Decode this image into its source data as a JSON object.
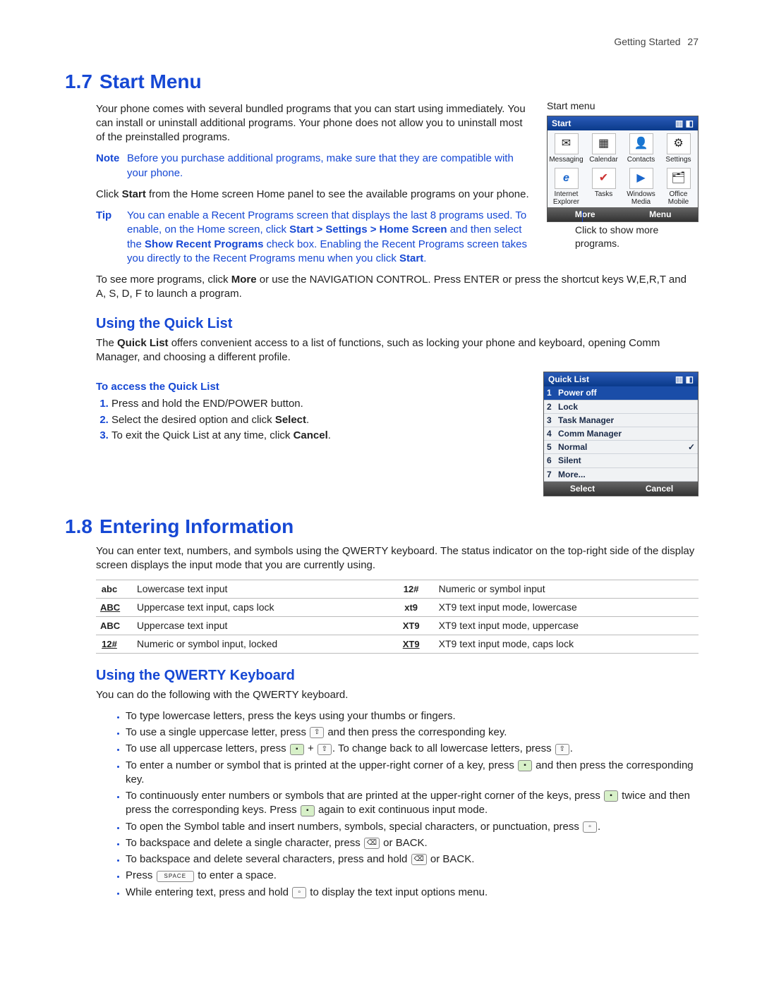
{
  "header": {
    "section": "Getting Started",
    "page": "27"
  },
  "sec17": {
    "num": "1.7",
    "title": "Start Menu",
    "intro": "Your phone comes with several bundled programs that you can start using immediately. You can install or uninstall additional programs. Your phone does not allow you to uninstall most of the preinstalled programs.",
    "note_label": "Note",
    "note": "Before you purchase additional programs, make sure that they are compatible with your phone.",
    "click_start_pre": "Click ",
    "click_start_bold": "Start",
    "click_start_post": " from the Home screen Home panel to see the available programs on your phone.",
    "tip_label": "Tip",
    "tip_pre": "You can enable a Recent Programs screen that displays the last 8 programs used. To enable, on the Home screen, click ",
    "tip_b1": "Start > Settings > Home Screen",
    "tip_mid": " and then select the ",
    "tip_b2": "Show Recent Programs",
    "tip_post": " check box. Enabling the Recent Programs screen takes you directly to the Recent Programs menu when you click ",
    "tip_b3": "Start",
    "more_pre": "To see more programs, click ",
    "more_bold": "More",
    "more_post": " or use the NAVIGATION CONTROL. Press ENTER or press the shortcut keys W,E,R,T and A, S, D, F to launch a program.",
    "fig_caption": "Start menu",
    "fig": {
      "title": "Start",
      "icons": [
        {
          "glyph": "✉",
          "label": "Messaging"
        },
        {
          "glyph": "▦",
          "label": "Calendar"
        },
        {
          "glyph": "👤",
          "label": "Contacts"
        },
        {
          "glyph": "⚙",
          "label": "Settings"
        },
        {
          "glyph": "e",
          "label": "Internet Explorer"
        },
        {
          "glyph": "✔",
          "label": "Tasks"
        },
        {
          "glyph": "▶",
          "label": "Windows Media"
        },
        {
          "glyph": "🗂",
          "label": "Office Mobile"
        }
      ],
      "soft_left": "More",
      "soft_right": "Menu"
    },
    "arrow_caption": "Click to show more programs."
  },
  "quicklist": {
    "heading": "Using the Quick List",
    "intro_pre": "The ",
    "intro_bold": "Quick List",
    "intro_post": " offers convenient access to a list of functions, such as locking your phone and keyboard, opening Comm Manager, and choosing a different profile.",
    "sub": "To access the Quick List",
    "steps": [
      {
        "pre": "Press and hold the END/POWER button."
      },
      {
        "pre": "Select the desired option and click ",
        "bold": "Select",
        "post": "."
      },
      {
        "pre": "To exit the Quick List at any time, click ",
        "bold": "Cancel",
        "post": "."
      }
    ],
    "fig": {
      "title": "Quick List",
      "items": [
        {
          "n": "1",
          "label": "Power off",
          "selected": true
        },
        {
          "n": "2",
          "label": "Lock"
        },
        {
          "n": "3",
          "label": "Task Manager"
        },
        {
          "n": "4",
          "label": "Comm Manager"
        },
        {
          "n": "5",
          "label": "Normal",
          "check": true
        },
        {
          "n": "6",
          "label": "Silent"
        },
        {
          "n": "7",
          "label": "More..."
        }
      ],
      "soft_left": "Select",
      "soft_right": "Cancel"
    }
  },
  "sec18": {
    "num": "1.8",
    "title": "Entering Information",
    "intro": "You can enter text, numbers, and symbols using the QWERTY keyboard. The status indicator on the top-right side of the display screen displays the input mode that you are currently using.",
    "modes": [
      {
        "icon": "abc",
        "desc": "Lowercase text input",
        "icon2": "12#",
        "desc2": "Numeric or symbol input"
      },
      {
        "icon": "ABC",
        "desc": "Uppercase text input, caps lock",
        "icon2": "xt9",
        "desc2": "XT9 text input mode, lowercase"
      },
      {
        "icon": "ABC",
        "desc": "Uppercase text input",
        "icon2": "XT9",
        "desc2": "XT9 text input mode, uppercase"
      },
      {
        "icon": "12#",
        "desc": "Numeric or symbol input, locked",
        "icon2": "XT9",
        "desc2": "XT9 text input mode, caps lock"
      }
    ]
  },
  "qwerty": {
    "heading": "Using the QWERTY Keyboard",
    "intro": "You can do the following with the QWERTY keyboard.",
    "b1": "To type lowercase letters, press the keys using your thumbs or fingers.",
    "b2_pre": "To use a single uppercase letter, press ",
    "b2_key": "⇧",
    "b2_post": " and then press the corresponding key.",
    "b3_pre": "To use all uppercase letters, press ",
    "b3_post_mid": ". To change back to all lowercase letters, press ",
    "b4_pre": "To enter a number or symbol that is printed at the upper-right corner of a key, press ",
    "b4_post": " and then press the corresponding key.",
    "b5_pre": "To continuously enter numbers or symbols that are printed at the upper-right corner of the keys, press ",
    "b5_mid": " twice and then press the corresponding keys. Press ",
    "b5_post": " again to exit continuous input mode.",
    "b6_pre": "To open the Symbol table and insert numbers, symbols, special characters, or punctuation, press ",
    "b7_pre": "To backspace and delete a single character, press ",
    "b7_post": " or BACK.",
    "b8_pre": "To backspace and delete several characters, press and hold ",
    "b8_post": " or BACK.",
    "b9_pre": "Press ",
    "b9_key": "SPACE",
    "b9_post": " to enter a space.",
    "b10_pre": "While entering text, press and hold ",
    "b10_post": " to display the text input options menu."
  }
}
